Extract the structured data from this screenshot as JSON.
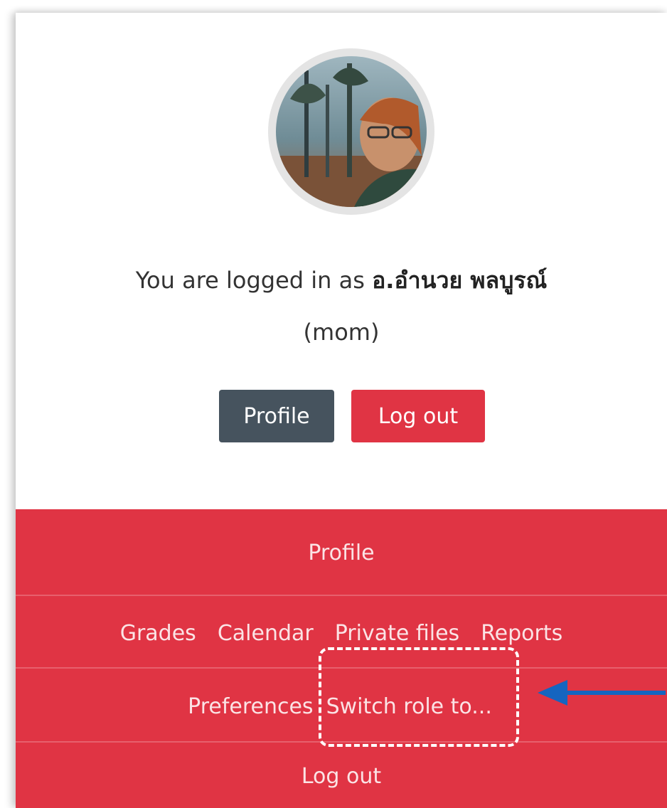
{
  "user": {
    "logged_in_prefix": "You are logged in as ",
    "display_name": "อ.อำนวย พลบูรณ์",
    "username": "(mom)"
  },
  "buttons": {
    "profile": "Profile",
    "logout": "Log out"
  },
  "menu": {
    "profile": "Profile",
    "grades": "Grades",
    "calendar": "Calendar",
    "private_files": "Private files",
    "reports": "Reports",
    "preferences": "Preferences",
    "switch_role": "Switch role to...",
    "logout": "Log out"
  },
  "colors": {
    "accent_red": "#e03444",
    "profile_button": "#46535e",
    "annotation_arrow": "#1565c0"
  }
}
